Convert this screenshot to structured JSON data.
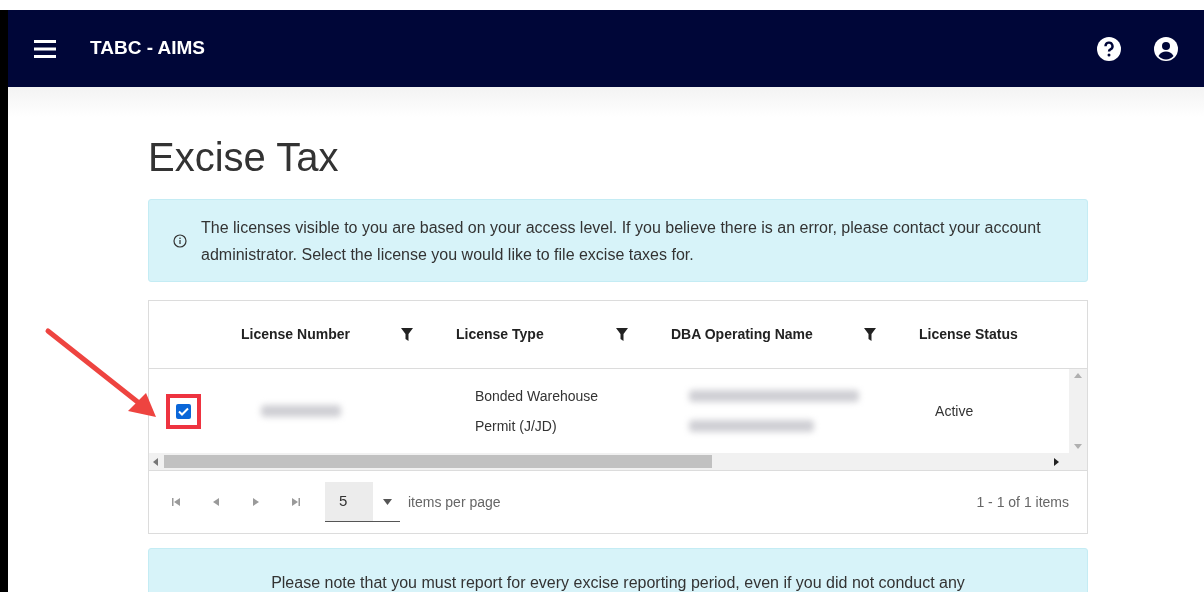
{
  "app_bar": {
    "title": "TABC - AIMS"
  },
  "page_title": "Excise Tax",
  "info_alert": {
    "text": "The licenses visible to you are based on your access level. If you believe there is an error, please contact your account administrator. Select the license you would like to file excise taxes for."
  },
  "grid": {
    "columns": [
      {
        "label": "License Number",
        "filterable": true
      },
      {
        "label": "License Type",
        "filterable": true
      },
      {
        "label": "DBA Operating Name",
        "filterable": true
      },
      {
        "label": "License Status",
        "filterable": false
      }
    ],
    "rows": [
      {
        "checked": true,
        "license_type": "Bonded Warehouse Permit (J/JD)",
        "license_status": "Active"
      }
    ],
    "pager": {
      "page_size": "5",
      "page_size_label": "items per page",
      "summary": "1 - 1 of 1 items"
    }
  },
  "note": {
    "text": "Please note that you must report for every excise reporting period, even if you did not conduct any"
  }
}
